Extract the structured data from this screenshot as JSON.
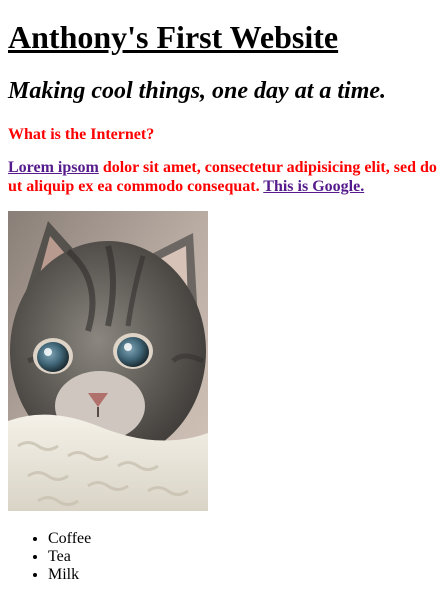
{
  "site": {
    "title": "Anthony's First Website",
    "subtitle": "Making cool things, one day at a time.",
    "question": "What is the Internet?"
  },
  "paragraph": {
    "link1_text": "Lorem ipsom",
    "text1": " dolor sit amet, consectetur adipisicing elit, sed do",
    "text2": "ut aliquip ex ea commodo consequat. ",
    "link2_text": "This is Google."
  },
  "image": {
    "alt": "kitten"
  },
  "list": {
    "items": [
      "Coffee",
      "Tea",
      "Milk"
    ]
  },
  "colors": {
    "heading_red": "#ff0000",
    "visited_link": "#551a8b"
  }
}
